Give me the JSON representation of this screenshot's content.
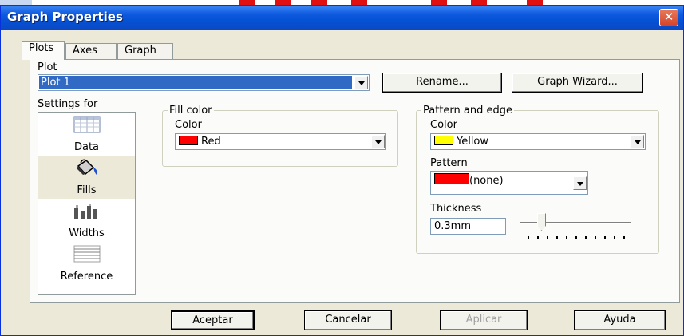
{
  "window": {
    "title": "Graph Properties",
    "close_glyph": "✕"
  },
  "tabs": [
    {
      "label": "Plots",
      "active": true
    },
    {
      "label": "Axes",
      "active": false
    },
    {
      "label": "Graph",
      "active": false
    }
  ],
  "plot": {
    "label": "Plot",
    "selected": "Plot 1",
    "rename_label": "Rename...",
    "wizard_label": "Graph Wizard..."
  },
  "settings": {
    "label": "Settings for",
    "items": [
      {
        "label": "Data",
        "icon": "data-grid-icon"
      },
      {
        "label": "Fills",
        "icon": "paint-bucket-icon"
      },
      {
        "label": "Widths",
        "icon": "bar-widths-icon"
      },
      {
        "label": "Reference",
        "icon": "reference-lines-icon"
      }
    ],
    "active": "Fills"
  },
  "fill_color": {
    "legend": "Fill color",
    "color_label": "Color",
    "value": "Red",
    "swatch": "#ff0000"
  },
  "pattern_edge": {
    "legend": "Pattern and edge",
    "color_label": "Color",
    "color_value": "Yellow",
    "color_swatch": "#ffff00",
    "pattern_label": "Pattern",
    "pattern_value": "(none)",
    "pattern_swatch": "#ff0000",
    "thickness_label": "Thickness",
    "thickness_value": "0.3mm"
  },
  "buttons": {
    "ok": "Aceptar",
    "cancel": "Cancelar",
    "apply": "Aplicar",
    "help": "Ayuda"
  },
  "colors": {
    "title_bar": "#0552d6",
    "dialog_bg": "#ece9d8",
    "selection": "#316ac5"
  }
}
